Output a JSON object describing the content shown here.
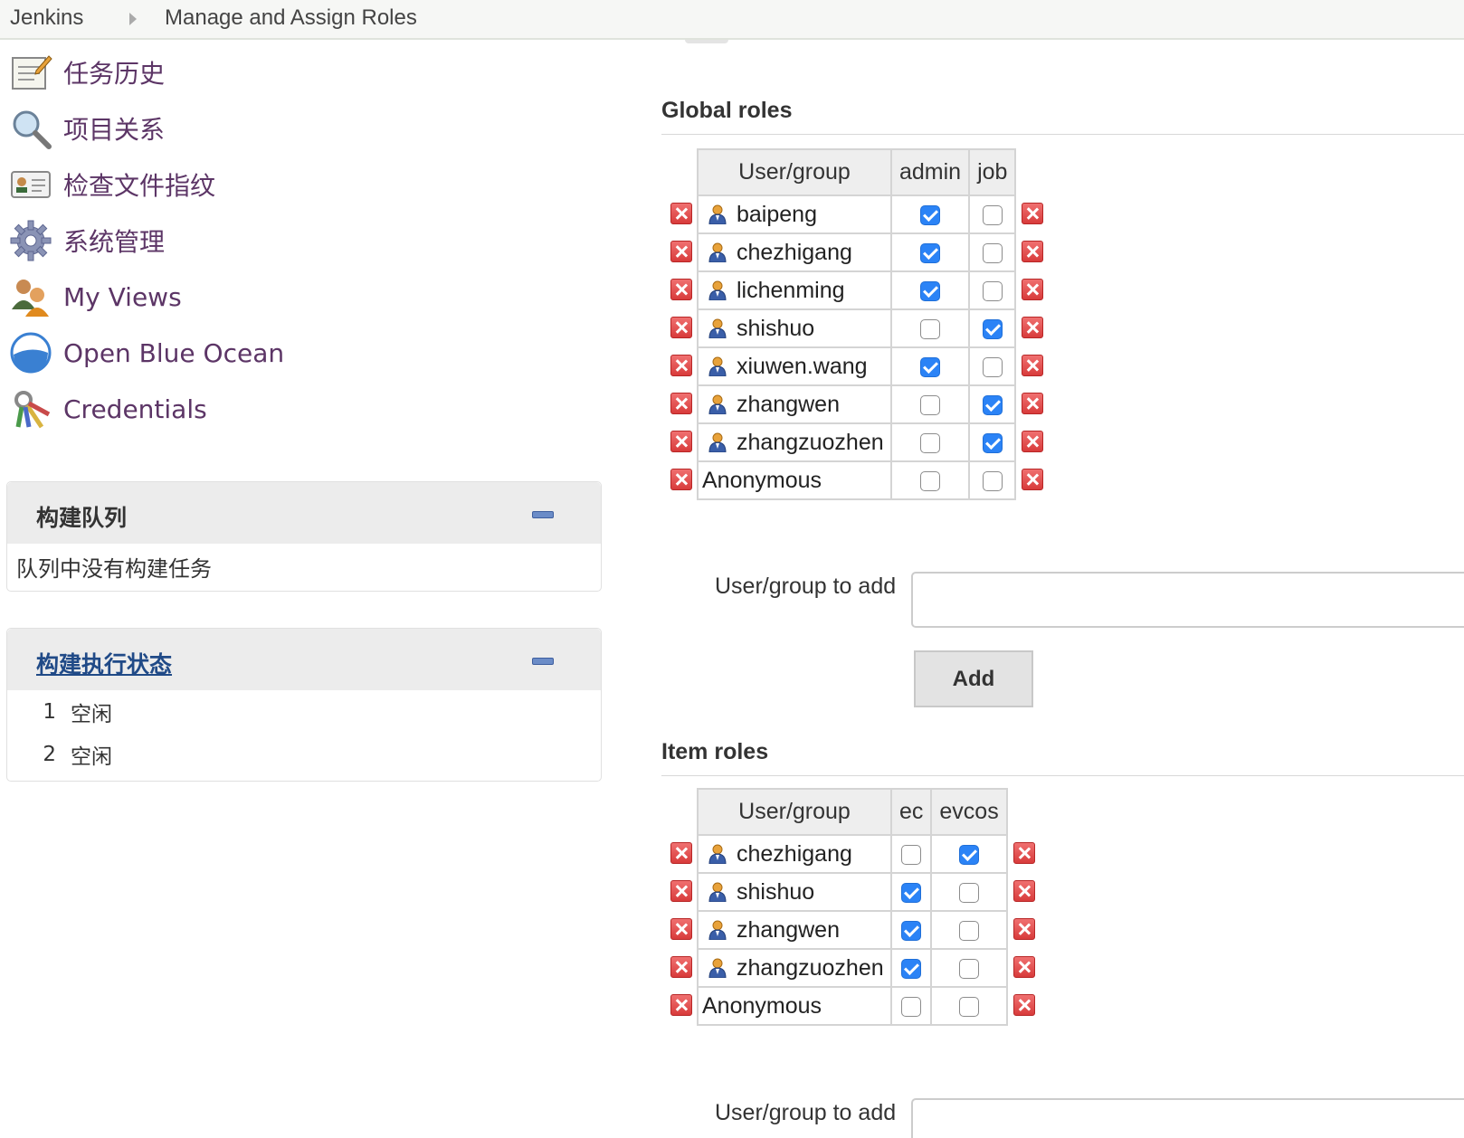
{
  "breadcrumb": {
    "root": "Jenkins",
    "page": "Manage and Assign Roles"
  },
  "sidebar": {
    "items": [
      {
        "label": "任务历史",
        "icon": "notepad-icon"
      },
      {
        "label": "项目关系",
        "icon": "magnifier-icon"
      },
      {
        "label": "检查文件指纹",
        "icon": "id-card-icon"
      },
      {
        "label": "系统管理",
        "icon": "gear-icon"
      },
      {
        "label": "My Views",
        "icon": "users-icon"
      },
      {
        "label": "Open Blue Ocean",
        "icon": "blue-ocean-icon"
      },
      {
        "label": "Credentials",
        "icon": "keys-icon"
      }
    ]
  },
  "build_queue": {
    "title": "构建队列",
    "empty_text": "队列中没有构建任务"
  },
  "executors": {
    "title": "构建执行状态",
    "rows": [
      {
        "num": "1",
        "status": "空闲"
      },
      {
        "num": "2",
        "status": "空闲"
      }
    ]
  },
  "global_roles": {
    "title": "Global roles",
    "header_user": "User/group",
    "columns": [
      "admin",
      "job"
    ],
    "rows": [
      {
        "name": "baipeng",
        "user": true,
        "checks": [
          true,
          false
        ]
      },
      {
        "name": "chezhigang",
        "user": true,
        "checks": [
          true,
          false
        ]
      },
      {
        "name": "lichenming",
        "user": true,
        "checks": [
          true,
          false
        ]
      },
      {
        "name": "shishuo",
        "user": true,
        "checks": [
          false,
          true
        ]
      },
      {
        "name": "xiuwen.wang",
        "user": true,
        "checks": [
          true,
          false
        ]
      },
      {
        "name": "zhangwen",
        "user": true,
        "checks": [
          false,
          true
        ]
      },
      {
        "name": "zhangzuozhen",
        "user": true,
        "checks": [
          false,
          true
        ]
      },
      {
        "name": "Anonymous",
        "user": false,
        "checks": [
          false,
          false
        ]
      }
    ],
    "add_label": "User/group to add",
    "add_value": "",
    "add_button": "Add"
  },
  "item_roles": {
    "title": "Item roles",
    "header_user": "User/group",
    "columns": [
      "ec",
      "evcos"
    ],
    "rows": [
      {
        "name": "chezhigang",
        "user": true,
        "checks": [
          false,
          true
        ]
      },
      {
        "name": "shishuo",
        "user": true,
        "checks": [
          true,
          false
        ]
      },
      {
        "name": "zhangwen",
        "user": true,
        "checks": [
          true,
          false
        ]
      },
      {
        "name": "zhangzuozhen",
        "user": true,
        "checks": [
          true,
          false
        ]
      },
      {
        "name": "Anonymous",
        "user": false,
        "checks": [
          false,
          false
        ]
      }
    ],
    "add_label": "User/group to add",
    "add_value": ""
  },
  "colors": {
    "link_purple": "#5c3566",
    "checkbox_blue": "#2b83f6",
    "delete_red": "#d83b3b"
  }
}
